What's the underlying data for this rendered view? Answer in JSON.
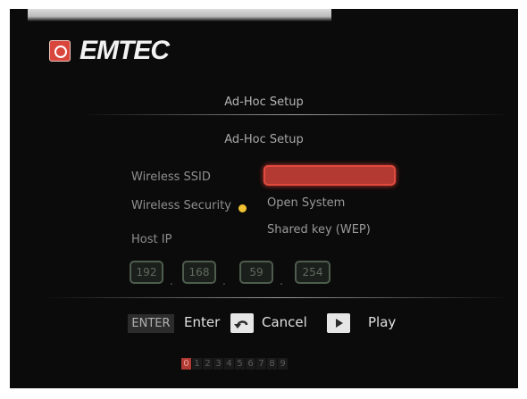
{
  "brand": {
    "logo_text": "EMTEC"
  },
  "header": {
    "title": "Ad-Hoc Setup"
  },
  "form": {
    "subtitle": "Ad-Hoc Setup",
    "ssid_label": "Wireless SSID",
    "security_label": "Wireless Security",
    "host_ip_label": "Host IP",
    "security_options": [
      "Open System",
      "Shared key (WEP)"
    ],
    "host_ip": [
      "192",
      "168",
      "59",
      "254"
    ]
  },
  "hints": {
    "enter_key": "ENTER",
    "enter": "Enter",
    "cancel": "Cancel",
    "play": "Play"
  },
  "pager": {
    "pages": [
      "0",
      "1",
      "2",
      "3",
      "4",
      "5",
      "6",
      "7",
      "8",
      "9"
    ],
    "active_index": 0
  },
  "colors": {
    "accent": "#b13a33",
    "selected_highlight": "#e34a3e",
    "indicator": "#f1c232",
    "background": "#0b0b0b"
  },
  "icons": {
    "return": "return-arrow-icon",
    "play": "play-icon",
    "logo": "emtec-logo-icon",
    "security_indicator": "yellow-dot-icon"
  }
}
